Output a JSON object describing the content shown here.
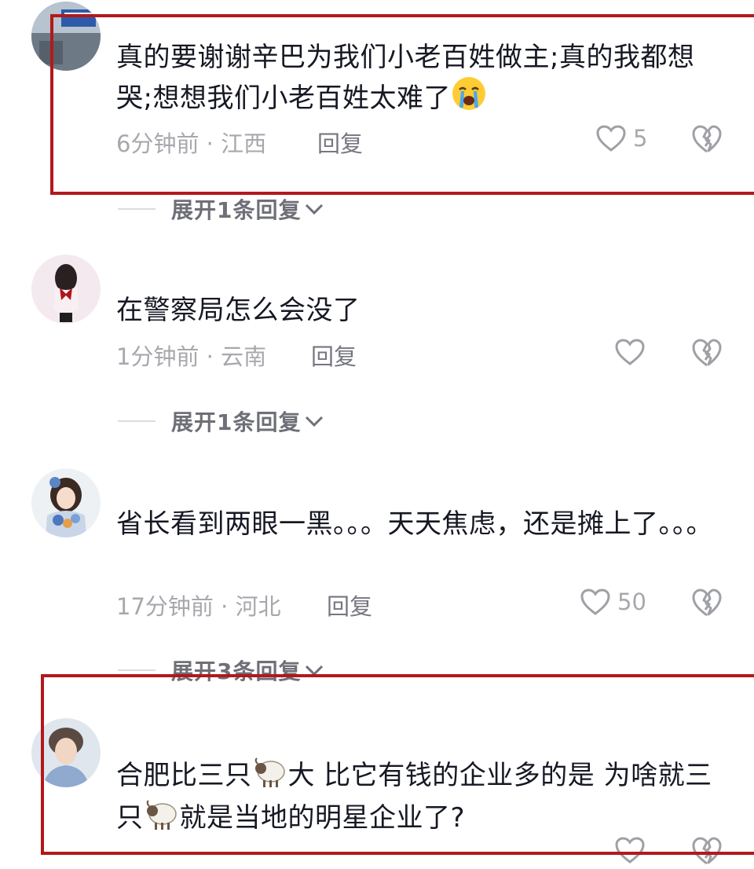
{
  "comments": [
    {
      "username": "",
      "text": "真的要谢谢辛巴为我们小老百姓做主;真的我都想哭;想想我们小老百姓太难了",
      "emoji": "loudly-crying-face",
      "time": "6分钟前",
      "location": "江西",
      "reply_label": "回复",
      "likes": "5",
      "expand_label": "展开1条回复"
    },
    {
      "username": "",
      "text": "在警察局怎么会没了",
      "time": "1分钟前",
      "location": "云南",
      "reply_label": "回复",
      "likes": "",
      "expand_label": "展开1条回复"
    },
    {
      "username": "",
      "text": "省长看到两眼一黑。。。天天焦虑，还是摊上了。。。",
      "time": "17分钟前",
      "location": "河北",
      "reply_label": "回复",
      "likes": "50",
      "expand_label": "展开3条回复"
    },
    {
      "username": "",
      "text_part1": "合肥比三只",
      "text_part2": "大 比它有钱的企业多的是 为啥就三只",
      "text_part3": "就是当地的明星企业了?",
      "emoji": "sheep",
      "time": "",
      "location": "",
      "reply_label": ""
    }
  ],
  "separator": " · ",
  "colors": {
    "highlight_box": "#b2191c",
    "text": "#161823",
    "meta": "#a7a8ad"
  }
}
